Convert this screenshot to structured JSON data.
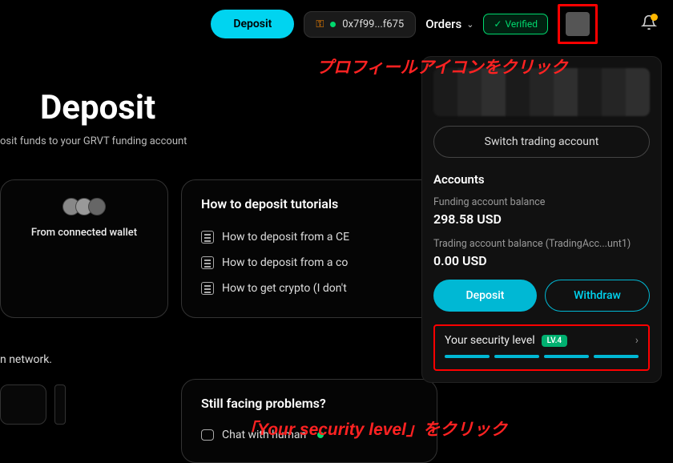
{
  "header": {
    "deposit_label": "Deposit",
    "wallet_addr": "0x7f99...f675",
    "orders_label": "Orders",
    "verified_label": "Verified"
  },
  "page": {
    "title": "Deposit",
    "subtitle": "osit funds to your GRVT funding account"
  },
  "wallet_card": {
    "desc": "From connected wallet"
  },
  "tutorials": {
    "title": "How to deposit tutorials",
    "items": [
      "How to deposit from a CE",
      "How to deposit from a co",
      "How to get crypto (I don't"
    ]
  },
  "problems": {
    "title": "Still facing problems?",
    "chat": "Chat with human"
  },
  "left_text": "n network.",
  "dropdown": {
    "switch_label": "Switch trading account",
    "section": "Accounts",
    "funding_label": "Funding account balance",
    "funding_val": "298.58 USD",
    "trading_label": "Trading account balance (TradingAcc...unt1)",
    "trading_val": "0.00 USD",
    "deposit": "Deposit",
    "withdraw": "Withdraw",
    "security_label": "Your security level",
    "level": "LV.4"
  },
  "annotations": {
    "a1": "プロフィールアイコンをクリック",
    "a2": "「Your security level」をクリック"
  }
}
